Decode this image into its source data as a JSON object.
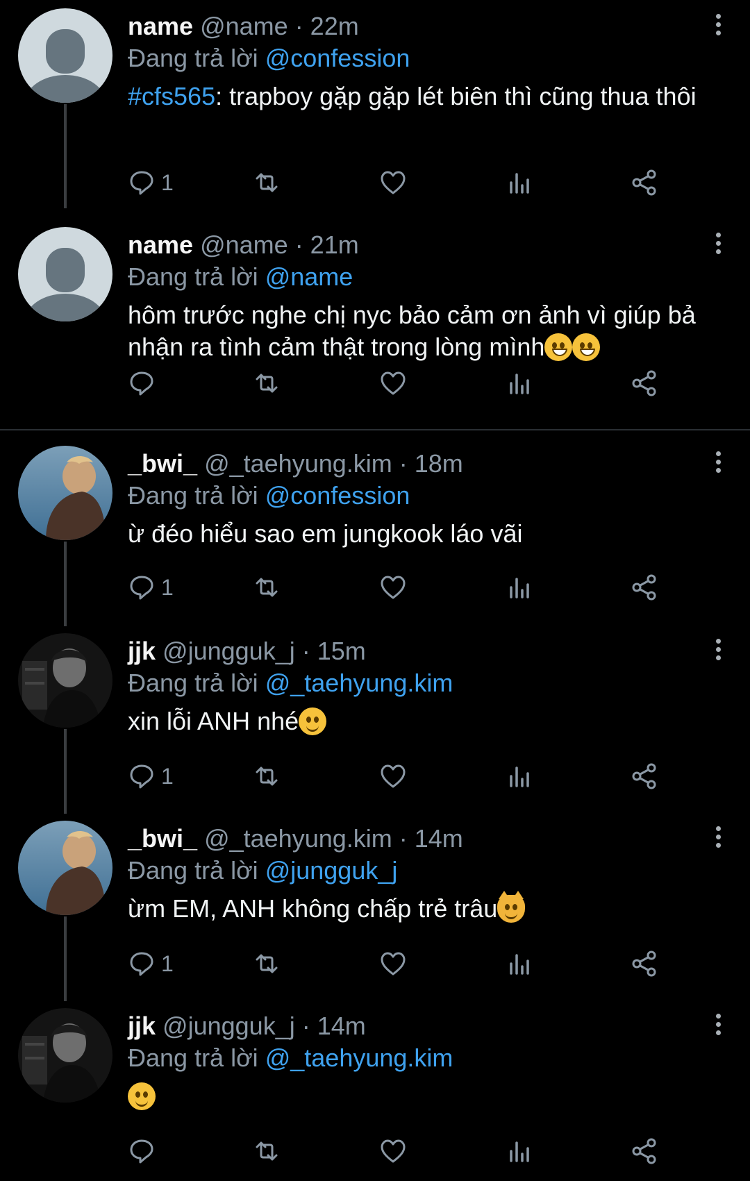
{
  "colors": {
    "background": "#000000",
    "mention": "#3fa2ef",
    "muted": "#8b98a5"
  },
  "reply_prefix": "Đang trả lời",
  "tweets": [
    {
      "display_name": "name",
      "handle": "@name",
      "time": "· 22m",
      "reply_to": "@confession",
      "hashtag": "#cfs565",
      "text": ": trapboy gặp gặp lét biên thì cũng thua thôi",
      "reply_count": "1",
      "avatar": "default-avatar"
    },
    {
      "display_name": "name",
      "handle": "@name",
      "time": "· 21m",
      "reply_to": "@name",
      "text": "hôm trước nghe chị nyc bảo cảm ơn ảnh vì giúp bả nhận ra tình cảm thật trong lòng mình",
      "emoji": [
        "grinning-squinting-face",
        "grinning-squinting-face"
      ],
      "reply_count": "",
      "avatar": "default-avatar"
    },
    {
      "display_name": "_bwi_",
      "handle": "@_taehyung.kim",
      "time": "· 18m",
      "reply_to": "@confession",
      "text": "ừ đéo hiểu sao em jungkook láo vãi",
      "reply_count": "1",
      "avatar": "photo-avatar-bwi"
    },
    {
      "display_name": "jjk",
      "handle": "@jungguk_j",
      "time": "· 15m",
      "reply_to": "@_taehyung.kim",
      "text": "xin lỗi ANH nhé",
      "emoji": [
        "slightly-smiling-face"
      ],
      "reply_count": "1",
      "avatar": "photo-avatar-jjk"
    },
    {
      "display_name": "_bwi_",
      "handle": "@_taehyung.kim",
      "time": "· 14m",
      "reply_to": "@jungguk_j",
      "text": "ừm EM, ANH không chấp trẻ trâu",
      "emoji": [
        "grinning-cat-face"
      ],
      "reply_count": "1",
      "avatar": "photo-avatar-bwi"
    },
    {
      "display_name": "jjk",
      "handle": "@jungguk_j",
      "time": "· 14m",
      "reply_to": "@_taehyung.kim",
      "text": "",
      "emoji": [
        "slightly-smiling-face"
      ],
      "reply_count": "",
      "avatar": "photo-avatar-jjk"
    }
  ]
}
